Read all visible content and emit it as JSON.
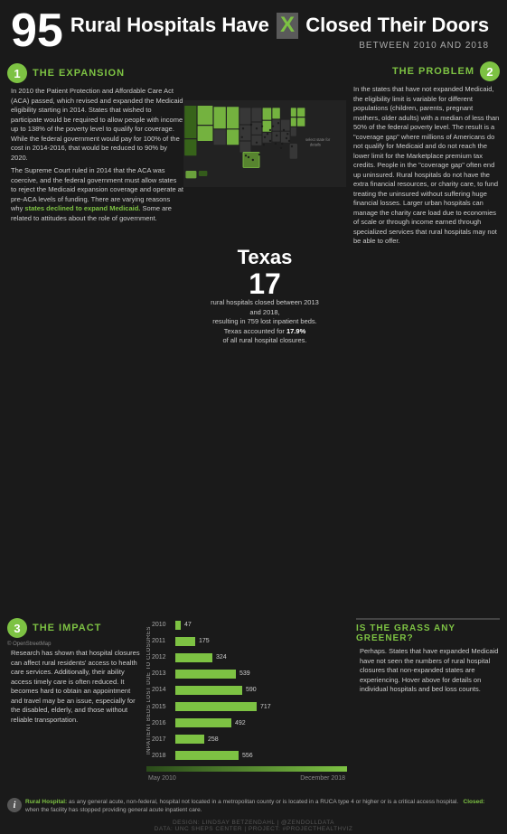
{
  "header": {
    "number": "95",
    "title_before": "Rural Hospitals Have",
    "title_x": "X",
    "title_after": "Closed Their Doors",
    "subtitle": "BETWEEN 2010 AND 2018"
  },
  "section1": {
    "number": "1",
    "title": "THE EXPANSION",
    "para1": "In 2010 the Patient Protection and Affordable Care Act (ACA) passed, which revised and expanded the Medicaid eligibility starting in 2014. States that wished to participate would be required to allow people with income up to 138% of the poverty level to qualify for coverage. While the federal government would pay for 100% of the cost in 2014-2016, that would be reduced to 90% by 2020.",
    "para2": "The Supreme Court ruled in 2014 that the ACA was coercive, and the federal government must allow states to reject the Medicaid expansion coverage and operate at pre-ACA levels of funding. There are varying reasons why states declined to expand Medicaid. Some are related to attitudes about the role of government."
  },
  "section2": {
    "number": "2",
    "title": "THE PROBLEM",
    "body": "In the states that have not expanded Medicaid, the eligibility limit is variable for different populations (children, parents, pregnant mothers, older adults) with a median of less than 50% of the federal poverty level. The result is a \"coverage gap\" where millions of Americans do not qualify for Medicaid and do not reach the lower limit for the Marketplace premium tax credits. People in the \"coverage gap\" often end up uninsured. Rural hospitals do not have the extra financial resources, or charity care, to fund treating the uninsured without suffering huge financial losses. Larger urban hospitals can manage the charity care load due to economies of scale or through income earned through specialized services that rural hospitals may not be able to offer."
  },
  "map": {
    "select_label": "select state for details",
    "state_highlighted": "Texas"
  },
  "texas": {
    "name": "Texas",
    "number": "17",
    "desc1": "rural hospitals closed between 2013 and 2018,",
    "desc2": "resulting in 759 lost inpatient beds.",
    "desc3": "Texas accounted for",
    "pct": "17.9%",
    "desc4": "of all rural hospital closures."
  },
  "section3": {
    "number": "3",
    "title": "THE IMPACT",
    "credit": "© OpenStreetMap",
    "body": "Research has shown that hospital closures can affect rural residents' access to health care services. Additionally, their ability access timely care is often reduced. It becomes hard to obtain an appointment and travel may be an issue, especially for the disabled, elderly, and those without reliable transportation."
  },
  "barchart": {
    "y_label": "INPATIENT BEDS LOST DUE TO CLOSURES",
    "bars": [
      {
        "year": "2010",
        "value": 47,
        "max": 800
      },
      {
        "year": "2011",
        "value": 175,
        "max": 800
      },
      {
        "year": "2012",
        "value": 324,
        "max": 800
      },
      {
        "year": "2013",
        "value": 539,
        "max": 800
      },
      {
        "year": "2014",
        "value": 590,
        "max": 800
      },
      {
        "year": "2015",
        "value": 717,
        "max": 800
      },
      {
        "year": "2016",
        "value": 492,
        "max": 800
      },
      {
        "year": "2017",
        "value": 258,
        "max": 800
      },
      {
        "year": "2018",
        "value": 556,
        "max": 800
      }
    ]
  },
  "timeline": {
    "start": "May 2010",
    "end": "December 2018"
  },
  "greener": {
    "title": "IS THE GRASS ANY GREENER?",
    "body": "Perhaps. States that have expanded Medicaid have not seen the numbers of rural hospital closures that non-expanded states are experiencing. Hover above for details on individual hospitals and bed loss counts."
  },
  "definitions": {
    "rural_hospital_term": "Rural Hospital:",
    "rural_hospital_def": "as any general acute, non-federal, hospital not located in a metropolitan county or is located in a RUCA type 4 or higher or is a critical access hospital.",
    "closed_term": "Closed:",
    "closed_def": "when the facility has stopped providing general acute inpatient care."
  },
  "credits": {
    "design": "DESIGN: LINDSAY BETZENDAHL | @ZENDOLLDATA",
    "data": "DATA: UNC SHEPS CENTER | PROJECT: #PROJECTHEALTHVIZ"
  },
  "colors": {
    "green": "#7dc243",
    "dark_bg": "#1a1a1a",
    "mid_bg": "#2a2a2a",
    "text_muted": "#aaa",
    "text_dim": "#666"
  }
}
